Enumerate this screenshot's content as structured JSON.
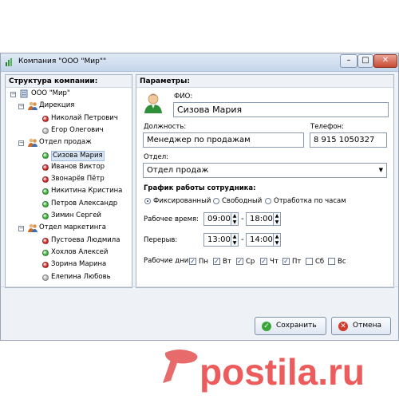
{
  "window": {
    "title": "Компания \"ООО \"Мир\"\"",
    "min": "–",
    "max": "□",
    "close": "✕"
  },
  "structure": {
    "heading": "Структура компании:",
    "tree": [
      {
        "level": 0,
        "text": "ООО \"Мир\"",
        "kind": "root"
      },
      {
        "level": 1,
        "text": "Дирекция",
        "kind": "group"
      },
      {
        "level": 2,
        "text": "Николай Петрович",
        "kind": "person",
        "status": "red"
      },
      {
        "level": 2,
        "text": "Егор Олегович",
        "kind": "person",
        "status": "grey"
      },
      {
        "level": 1,
        "text": "Отдел продаж",
        "kind": "group"
      },
      {
        "level": 2,
        "text": "Сизова Мария",
        "kind": "person",
        "status": "green",
        "selected": true
      },
      {
        "level": 2,
        "text": "Иванов Виктор",
        "kind": "person",
        "status": "red"
      },
      {
        "level": 2,
        "text": "Звонарёв Пётр",
        "kind": "person",
        "status": "red"
      },
      {
        "level": 2,
        "text": "Никитина Кристина",
        "kind": "person",
        "status": "green"
      },
      {
        "level": 2,
        "text": "Петров Александр",
        "kind": "person",
        "status": "green"
      },
      {
        "level": 2,
        "text": "Зимин Сергей",
        "kind": "person",
        "status": "green"
      },
      {
        "level": 1,
        "text": "Отдел маркетинга",
        "kind": "group"
      },
      {
        "level": 2,
        "text": "Пустоева Людмила",
        "kind": "person",
        "status": "red"
      },
      {
        "level": 2,
        "text": "Хохлов Алексей",
        "kind": "person",
        "status": "green"
      },
      {
        "level": 2,
        "text": "Зорина Марина",
        "kind": "person",
        "status": "red"
      },
      {
        "level": 2,
        "text": "Елепина Любовь",
        "kind": "person",
        "status": "grey"
      }
    ]
  },
  "params": {
    "heading": "Параметры:",
    "fio_label": "ФИО:",
    "fio_value": "Сизова Мария",
    "position_label": "Должность:",
    "position_value": "Менеджер по  продажам",
    "phone_label": "Телефон:",
    "phone_value": "8 915 1050327",
    "dept_label": "Отдел:",
    "dept_value": "Отдел продаж",
    "schedule_heading": "График работы сотрудника:",
    "schedule_options": [
      "Фиксированный",
      "Свободный",
      "Отработка по часам"
    ],
    "schedule_selected": 0,
    "work_time_label": "Рабочее время:",
    "work_from": "09:00",
    "work_to": "18:00",
    "break_label": "Перерыв:",
    "break_from": "13:00",
    "break_to": "14:00",
    "dash": "-",
    "days_label": "Рабочие дни:",
    "days": [
      {
        "label": "Пн",
        "checked": true
      },
      {
        "label": "Вт",
        "checked": true
      },
      {
        "label": "Ср",
        "checked": true
      },
      {
        "label": "Чт",
        "checked": true
      },
      {
        "label": "Пт",
        "checked": true
      },
      {
        "label": "Сб",
        "checked": false
      },
      {
        "label": "Вс",
        "checked": false
      }
    ]
  },
  "buttons": {
    "save": "Сохранить",
    "cancel": "Отмена"
  },
  "watermark": "postila.ru",
  "colors": {
    "status_green": "#3bb53b",
    "status_red": "#d42a2a",
    "status_grey": "#b8b8b8",
    "watermark": "#ec5c5c"
  }
}
